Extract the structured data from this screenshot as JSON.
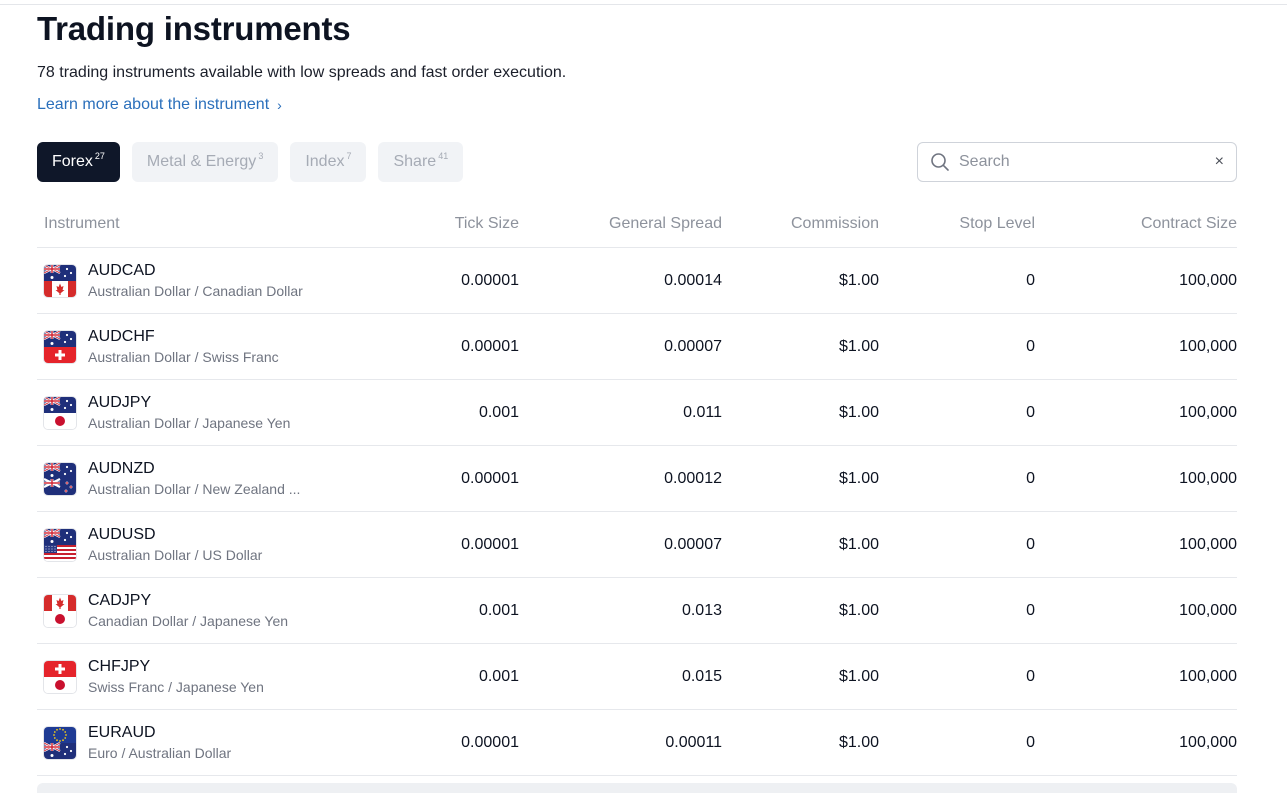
{
  "header": {
    "title": "Trading instruments",
    "subtitle": "78 trading instruments available with low spreads and fast order execution.",
    "learn_more": "Learn more about the instrument",
    "learn_more_chevron": "›"
  },
  "tabs": [
    {
      "label": "Forex",
      "count": "27",
      "active": true
    },
    {
      "label": "Metal & Energy",
      "count": "3",
      "active": false
    },
    {
      "label": "Index",
      "count": "7",
      "active": false
    },
    {
      "label": "Share",
      "count": "41",
      "active": false
    }
  ],
  "search": {
    "placeholder": "Search",
    "value": "",
    "clear_icon": "×"
  },
  "table": {
    "columns": {
      "instrument": "Instrument",
      "tick_size": "Tick Size",
      "general_spread": "General Spread",
      "commission": "Commission",
      "stop_level": "Stop Level",
      "contract_size": "Contract Size"
    },
    "rows": [
      {
        "symbol": "AUDCAD",
        "desc": "Australian Dollar / Canadian Dollar",
        "tick": "0.00001",
        "spread": "0.00014",
        "commission": "$1.00",
        "stop": "0",
        "size": "100,000",
        "flag_top": "australia-flag-icon",
        "flag_bottom": "canada-flag-icon"
      },
      {
        "symbol": "AUDCHF",
        "desc": "Australian Dollar / Swiss Franc",
        "tick": "0.00001",
        "spread": "0.00007",
        "commission": "$1.00",
        "stop": "0",
        "size": "100,000",
        "flag_top": "australia-flag-icon",
        "flag_bottom": "switzerland-flag-icon"
      },
      {
        "symbol": "AUDJPY",
        "desc": "Australian Dollar / Japanese Yen",
        "tick": "0.001",
        "spread": "0.011",
        "commission": "$1.00",
        "stop": "0",
        "size": "100,000",
        "flag_top": "australia-flag-icon",
        "flag_bottom": "japan-flag-icon"
      },
      {
        "symbol": "AUDNZD",
        "desc": "Australian Dollar / New Zealand ...",
        "tick": "0.00001",
        "spread": "0.00012",
        "commission": "$1.00",
        "stop": "0",
        "size": "100,000",
        "flag_top": "australia-flag-icon",
        "flag_bottom": "new-zealand-flag-icon"
      },
      {
        "symbol": "AUDUSD",
        "desc": "Australian Dollar / US Dollar",
        "tick": "0.00001",
        "spread": "0.00007",
        "commission": "$1.00",
        "stop": "0",
        "size": "100,000",
        "flag_top": "australia-flag-icon",
        "flag_bottom": "usa-flag-icon"
      },
      {
        "symbol": "CADJPY",
        "desc": "Canadian Dollar / Japanese Yen",
        "tick": "0.001",
        "spread": "0.013",
        "commission": "$1.00",
        "stop": "0",
        "size": "100,000",
        "flag_top": "canada-flag-icon",
        "flag_bottom": "japan-flag-icon"
      },
      {
        "symbol": "CHFJPY",
        "desc": "Swiss Franc / Japanese Yen",
        "tick": "0.001",
        "spread": "0.015",
        "commission": "$1.00",
        "stop": "0",
        "size": "100,000",
        "flag_top": "switzerland-flag-icon",
        "flag_bottom": "japan-flag-icon"
      },
      {
        "symbol": "EURAUD",
        "desc": "Euro / Australian Dollar",
        "tick": "0.00001",
        "spread": "0.00011",
        "commission": "$1.00",
        "stop": "0",
        "size": "100,000",
        "flag_top": "eu-flag-icon",
        "flag_bottom": "australia-flag-icon"
      }
    ]
  },
  "colors": {
    "accent_link": "#2a6fbb",
    "active_tab_bg": "#0f1729",
    "muted_text": "#8d929c",
    "row_divider": "#e6e8ec"
  }
}
